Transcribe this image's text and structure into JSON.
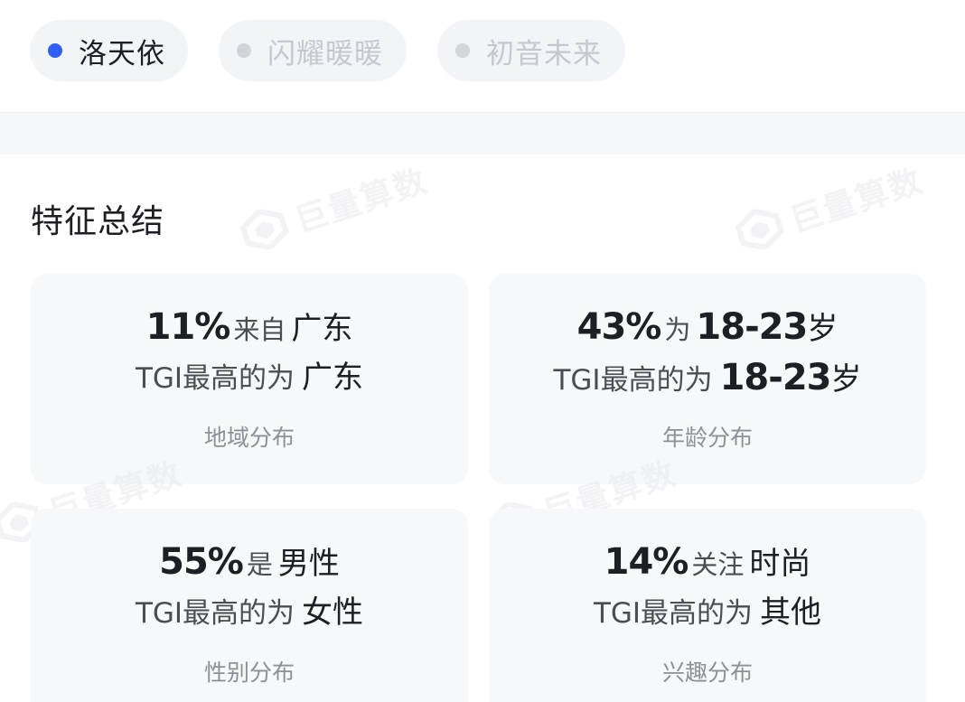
{
  "tabs": [
    {
      "label": "洛天依",
      "active": true
    },
    {
      "label": "闪耀暖暖",
      "active": false
    },
    {
      "label": "初音未来",
      "active": false
    }
  ],
  "section": {
    "title": "特征总结"
  },
  "watermark": {
    "text": "巨量算数",
    "icon": "juliang-logo-icon"
  },
  "cards": [
    {
      "line1": {
        "pct": "11%",
        "mid": "来自",
        "value": "广东"
      },
      "line2": {
        "prefix": "TGI最高的为",
        "value": "广东"
      },
      "caption": "地域分布"
    },
    {
      "line1": {
        "pct": "43%",
        "mid": "为",
        "value": "18-23",
        "suffix": "岁"
      },
      "line2": {
        "prefix": "TGI最高的为",
        "value": "18-23",
        "suffix": "岁"
      },
      "caption": "年龄分布"
    },
    {
      "line1": {
        "pct": "55%",
        "mid": "是",
        "value": "男性"
      },
      "line2": {
        "prefix": "TGI最高的为",
        "value": "女性"
      },
      "caption": "性别分布"
    },
    {
      "line1": {
        "pct": "14%",
        "mid": "关注",
        "value": "时尚"
      },
      "line2": {
        "prefix": "TGI最高的为",
        "value": "其他"
      },
      "caption": "兴趣分布"
    }
  ],
  "colors": {
    "accent": "#2f5ff3",
    "inactive_dot": "#d2d4d9",
    "card_bg": "#f7f8fa",
    "tab_bg": "#f3f4f7"
  }
}
